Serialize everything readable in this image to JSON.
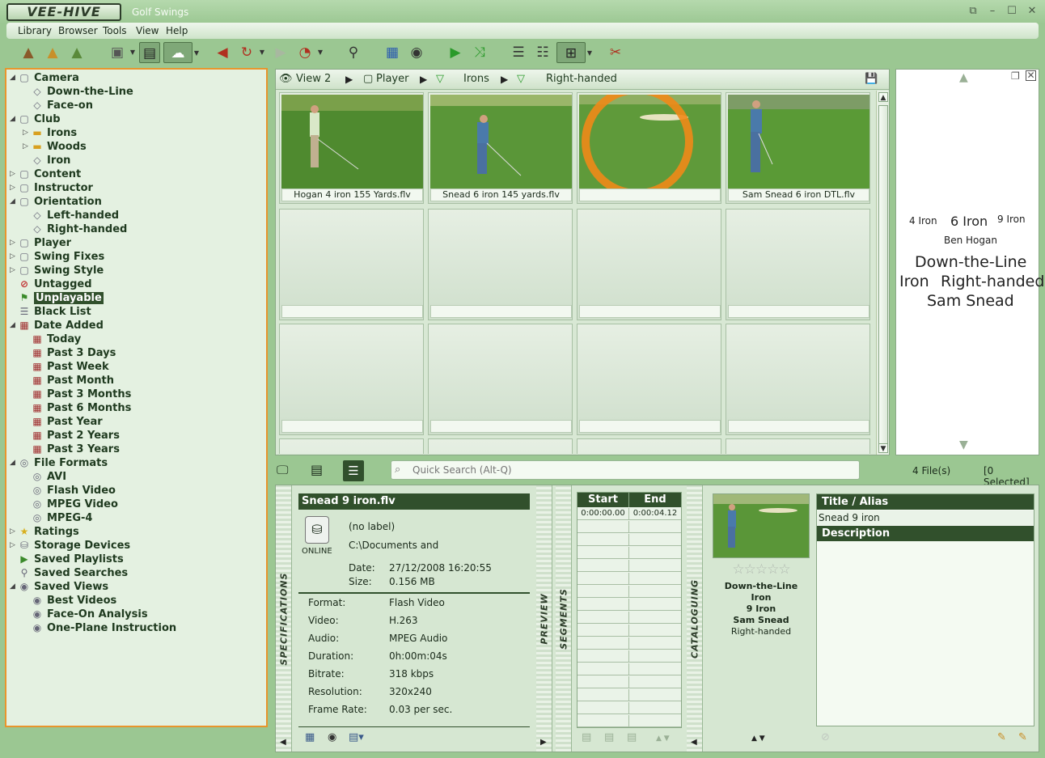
{
  "app": {
    "logo_text": "VEE-HIVE",
    "window_title": "Golf Swings"
  },
  "menu": [
    "Library",
    "Browser",
    "Tools",
    "View",
    "Help"
  ],
  "tree": [
    {
      "label": "Camera",
      "level": 0,
      "expand": "open",
      "icon": "folder-icon"
    },
    {
      "label": "Down-the-Line",
      "level": 1,
      "expand": "",
      "icon": "tag-icon"
    },
    {
      "label": "Face-on",
      "level": 1,
      "expand": "",
      "icon": "tag-icon"
    },
    {
      "label": "Club",
      "level": 0,
      "expand": "open",
      "icon": "folder-icon"
    },
    {
      "label": "Irons",
      "level": 1,
      "expand": "closed",
      "icon": "folder-yellow-icon"
    },
    {
      "label": "Woods",
      "level": 1,
      "expand": "closed",
      "icon": "folder-yellow-icon"
    },
    {
      "label": "Iron",
      "level": 1,
      "expand": "",
      "icon": "tag-icon"
    },
    {
      "label": "Content",
      "level": 0,
      "expand": "closed",
      "icon": "folder-icon"
    },
    {
      "label": "Instructor",
      "level": 0,
      "expand": "closed",
      "icon": "folder-icon"
    },
    {
      "label": "Orientation",
      "level": 0,
      "expand": "open",
      "icon": "folder-icon"
    },
    {
      "label": "Left-handed",
      "level": 1,
      "expand": "",
      "icon": "tag-icon"
    },
    {
      "label": "Right-handed",
      "level": 1,
      "expand": "",
      "icon": "tag-icon"
    },
    {
      "label": "Player",
      "level": 0,
      "expand": "closed",
      "icon": "folder-icon"
    },
    {
      "label": "Swing Fixes",
      "level": 0,
      "expand": "closed",
      "icon": "folder-icon"
    },
    {
      "label": "Swing Style",
      "level": 0,
      "expand": "closed",
      "icon": "folder-icon"
    },
    {
      "label": "Untagged",
      "level": 0,
      "expand": "",
      "icon": "untagged-icon"
    },
    {
      "label": "Unplayable",
      "level": 0,
      "expand": "",
      "icon": "unplayable-icon",
      "selected": true
    },
    {
      "label": "Black List",
      "level": 0,
      "expand": "",
      "icon": "list-icon"
    },
    {
      "label": "Date Added",
      "level": 0,
      "expand": "open",
      "icon": "calendar-icon"
    },
    {
      "label": "Today",
      "level": 1,
      "expand": "",
      "icon": "calendar-icon"
    },
    {
      "label": "Past 3 Days",
      "level": 1,
      "expand": "",
      "icon": "calendar-icon"
    },
    {
      "label": "Past Week",
      "level": 1,
      "expand": "",
      "icon": "calendar-icon"
    },
    {
      "label": "Past Month",
      "level": 1,
      "expand": "",
      "icon": "calendar-icon"
    },
    {
      "label": "Past 3 Months",
      "level": 1,
      "expand": "",
      "icon": "calendar-icon"
    },
    {
      "label": "Past 6 Months",
      "level": 1,
      "expand": "",
      "icon": "calendar-icon"
    },
    {
      "label": "Past Year",
      "level": 1,
      "expand": "",
      "icon": "calendar-icon"
    },
    {
      "label": "Past 2 Years",
      "level": 1,
      "expand": "",
      "icon": "calendar-icon"
    },
    {
      "label": "Past 3 Years",
      "level": 1,
      "expand": "",
      "icon": "calendar-icon"
    },
    {
      "label": "File Formats",
      "level": 0,
      "expand": "open",
      "icon": "disc-icon"
    },
    {
      "label": "AVI",
      "level": 1,
      "expand": "",
      "icon": "disc-icon"
    },
    {
      "label": "Flash Video",
      "level": 1,
      "expand": "",
      "icon": "disc-icon"
    },
    {
      "label": "MPEG Video",
      "level": 1,
      "expand": "",
      "icon": "disc-icon"
    },
    {
      "label": "MPEG-4",
      "level": 1,
      "expand": "",
      "icon": "disc-icon"
    },
    {
      "label": "Ratings",
      "level": 0,
      "expand": "closed",
      "icon": "star-icon"
    },
    {
      "label": "Storage Devices",
      "level": 0,
      "expand": "closed",
      "icon": "drive-icon"
    },
    {
      "label": "Saved Playlists",
      "level": 0,
      "expand": "",
      "icon": "playlist-icon"
    },
    {
      "label": "Saved Searches",
      "level": 0,
      "expand": "",
      "icon": "search-icon"
    },
    {
      "label": "Saved Views",
      "level": 0,
      "expand": "open",
      "icon": "eye-icon"
    },
    {
      "label": "Best Videos",
      "level": 1,
      "expand": "",
      "icon": "eye-icon"
    },
    {
      "label": "Face-On Analysis",
      "level": 1,
      "expand": "",
      "icon": "eye-icon"
    },
    {
      "label": "One-Plane Instruction",
      "level": 1,
      "expand": "",
      "icon": "eye-icon"
    }
  ],
  "breadcrumb": {
    "view": "View 2",
    "player": "Player",
    "irons": "Irons",
    "handed": "Right-handed"
  },
  "thumbnails": [
    {
      "caption": "Hogan 4 iron 155 Yards.flv"
    },
    {
      "caption": "Snead 6 iron 145 yards.flv"
    },
    {
      "caption": ""
    },
    {
      "caption": "Sam Snead 6 iron DTL.flv"
    }
  ],
  "cloud": {
    "w1": "4 Iron",
    "w2": "6 Iron",
    "w3": "9 Iron",
    "w4": "Ben Hogan",
    "w5": "Down-the-Line",
    "w6": "Iron",
    "w7": "Right-handed",
    "w8": "Sam Snead"
  },
  "status": {
    "search_placeholder": "Quick Search (Alt-Q)",
    "file_count": "4 File(s)",
    "selected_count": "[0 Selected]"
  },
  "tabs": {
    "specifications": "SPECIFICATIONS",
    "preview": "PREVIEW",
    "segments": "SEGMENTS",
    "cataloguing": "CATALOGUING"
  },
  "spec": {
    "title": "Snead 9 iron.flv",
    "label": "(no label)",
    "path": "C:\\Documents and",
    "online": "ONLINE",
    "date_label": "Date:",
    "date_value": "27/12/2008 16:20:55",
    "size_label": "Size:",
    "size_value": "0.156 MB",
    "rows": [
      {
        "label": "Format:",
        "value": "Flash Video"
      },
      {
        "label": "Video:",
        "value": "H.263"
      },
      {
        "label": "Audio:",
        "value": "MPEG Audio"
      },
      {
        "label": "Duration:",
        "value": "0h:00m:04s"
      },
      {
        "label": "Bitrate:",
        "value": "318 kbps"
      },
      {
        "label": "Resolution:",
        "value": "320x240"
      },
      {
        "label": "Frame Rate:",
        "value": "0.03 per sec."
      }
    ]
  },
  "segments": {
    "start_header": "Start",
    "end_header": "End",
    "first_start": "0:00:00.00",
    "first_end": "0:00:04.12"
  },
  "cataloguing": {
    "rating": 0,
    "line1": "Down-the-Line",
    "line2": "Iron",
    "line3": "9 Iron",
    "line4": "Sam Snead",
    "line5": "Right-handed"
  },
  "meta": {
    "title_header": "Title / Alias",
    "title_value": "Snead 9 iron",
    "description_header": "Description"
  }
}
